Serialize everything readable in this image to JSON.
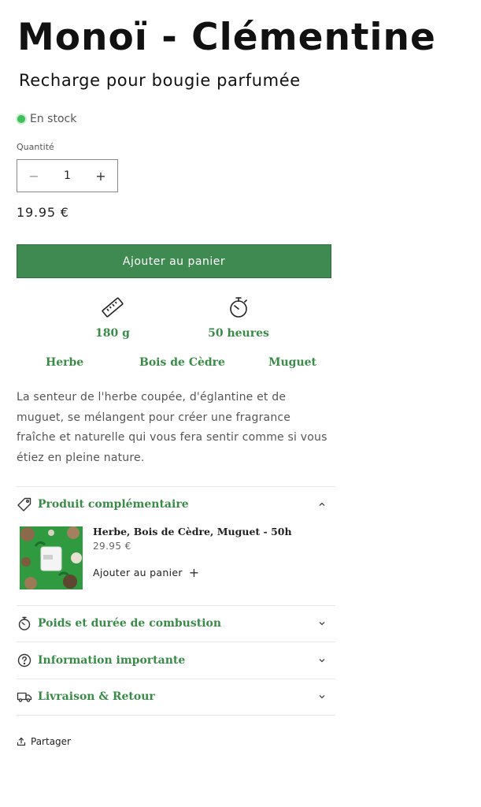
{
  "product": {
    "title": "Monoï - Clémentine",
    "subtitle": "Recharge pour bougie parfumée",
    "stock": "En stock",
    "quantity_label": "Quantité",
    "quantity": "1",
    "minus": "−",
    "plus": "+",
    "price": "19.95 €",
    "add_to_cart": "Ajouter au panier"
  },
  "features": [
    {
      "icon": "ruler-icon",
      "label": "180 g"
    },
    {
      "icon": "stopwatch-icon",
      "label": "50 heures"
    }
  ],
  "notes": [
    "Herbe",
    "Bois de Cèdre",
    "Muguet"
  ],
  "description": "La senteur de l'herbe coupée, d'églantine et de muguet, se mélangent pour créer une fragrance fraîche et naturelle qui vous fera sentir comme si vous étiez en pleine nature.",
  "accordion": [
    {
      "icon": "tag-icon",
      "title": "Produit complémentaire",
      "expanded": true
    },
    {
      "icon": "stopwatch-icon",
      "title": "Poids et durée de combustion",
      "expanded": false
    },
    {
      "icon": "question-circle-icon",
      "title": "Information importante",
      "expanded": false
    },
    {
      "icon": "truck-icon",
      "title": "Livraison & Retour",
      "expanded": false
    }
  ],
  "complementary": {
    "name": "Herbe, Bois de Cèdre, Muguet - 50h",
    "price": "29.95 €",
    "add": "Ajouter au panier",
    "add_icon": "+"
  },
  "share": "Partager",
  "colors": {
    "accent_green": "#3a8a48",
    "button_green": "#3f8a50",
    "stock_dot": "#3fbf5a"
  }
}
